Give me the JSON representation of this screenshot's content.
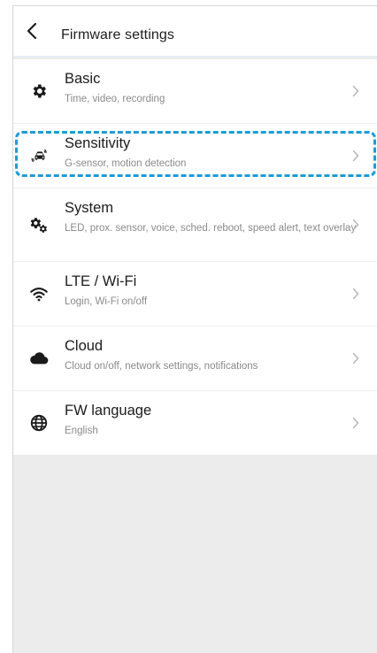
{
  "header": {
    "title": "Firmware settings"
  },
  "items": [
    {
      "icon": "gear-icon",
      "title": "Basic",
      "subtitle": "Time, video, recording"
    },
    {
      "icon": "car-sensor-icon",
      "title": "Sensitivity",
      "subtitle": "G-sensor, motion detection"
    },
    {
      "icon": "gears-icon",
      "title": "System",
      "subtitle": "LED, prox. sensor, voice, sched. reboot, speed alert, text overlay"
    },
    {
      "icon": "wifi-icon",
      "title": "LTE / Wi-Fi",
      "subtitle": "Login, Wi-Fi on/off"
    },
    {
      "icon": "cloud-icon",
      "title": "Cloud",
      "subtitle": "Cloud on/off, network settings, notifications"
    },
    {
      "icon": "globe-icon",
      "title": "FW language",
      "subtitle": "English"
    }
  ],
  "colors": {
    "highlight": "#1e9bd7",
    "background": "#ececec"
  }
}
